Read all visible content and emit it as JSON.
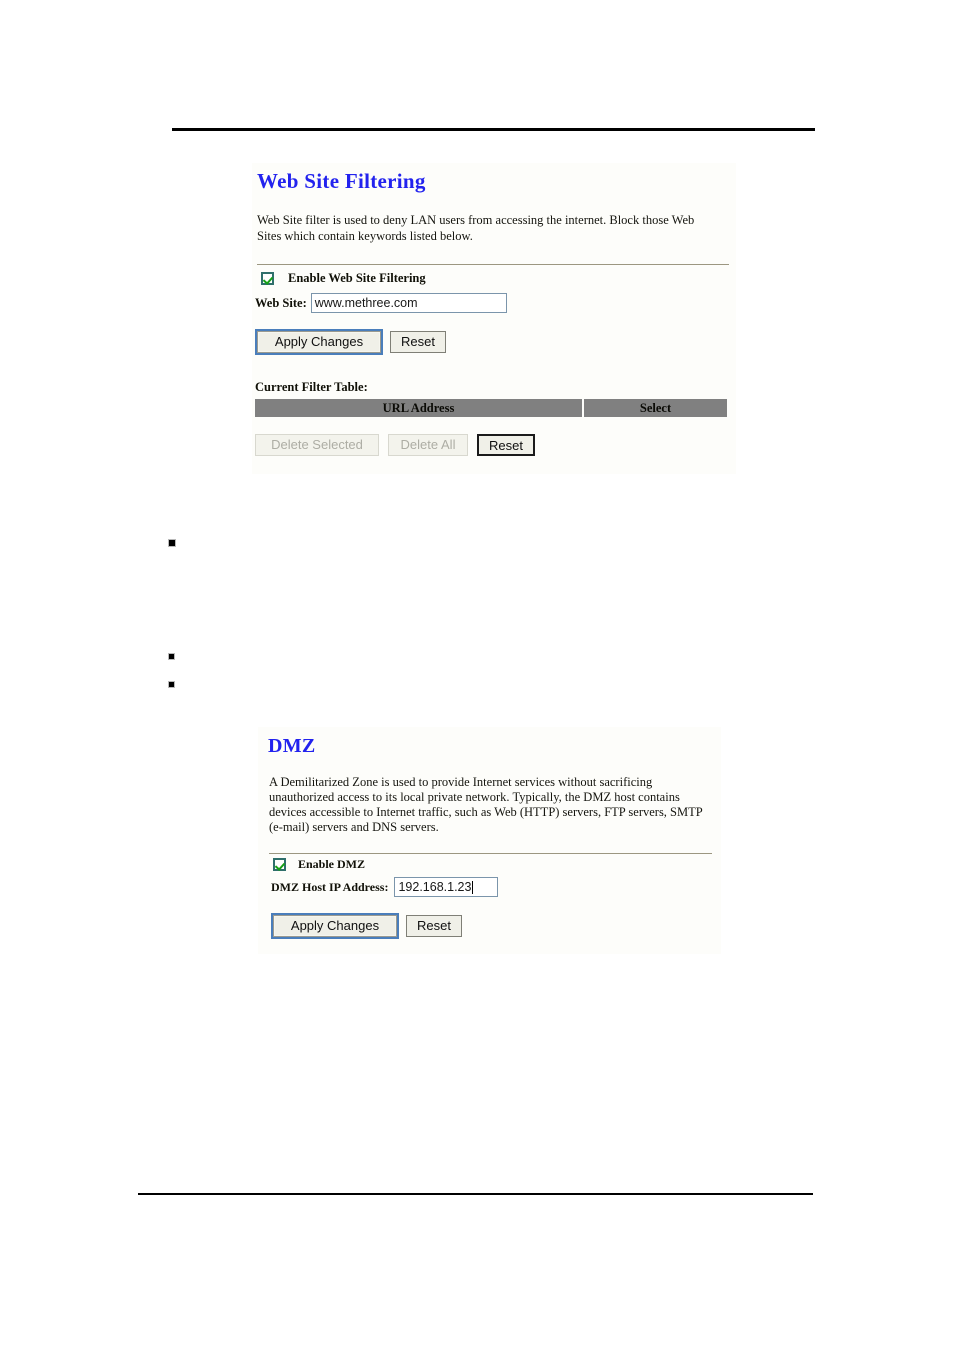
{
  "document": {
    "header_rule": true,
    "footer_rule": true,
    "bullets": [
      "",
      "",
      ""
    ]
  },
  "website_filtering": {
    "title": "Web Site Filtering",
    "description": "Web Site filter is used to deny LAN users from accessing the internet. Block those Web Sites which contain keywords listed below.",
    "enable_checkbox": {
      "label": "Enable Web Site Filtering",
      "checked": true,
      "icon": "checkbox-checked-icon"
    },
    "web_site_field": {
      "label": "Web Site:",
      "value": "www.methree.com",
      "placeholder": ""
    },
    "apply_label": "Apply Changes",
    "reset_label": "Reset",
    "table": {
      "caption": "Current Filter Table:",
      "columns": [
        "URL Address",
        "Select"
      ],
      "rows": [],
      "header_bg": "#808080"
    },
    "table_actions": {
      "delete_selected_label": "Delete Selected",
      "delete_selected_disabled": true,
      "delete_all_label": "Delete All",
      "delete_all_disabled": true,
      "reset_label": "Reset"
    }
  },
  "dmz": {
    "title": "DMZ",
    "description": "A Demilitarized Zone is used to provide Internet services without sacrificing unauthorized access to its local private network. Typically, the DMZ host contains devices accessible to Internet traffic, such as Web (HTTP) servers, FTP servers, SMTP (e-mail) servers and DNS servers.",
    "enable_checkbox": {
      "label": "Enable DMZ",
      "checked": true,
      "icon": "checkbox-checked-icon"
    },
    "host_ip_field": {
      "label": "DMZ Host IP Address:",
      "value": "192.168.1.23",
      "placeholder": ""
    },
    "apply_label": "Apply Changes",
    "reset_label": "Reset"
  },
  "colors": {
    "title_blue": "#2222ee",
    "table_header_gray": "#808080",
    "checkbox_border": "#2f6f6b",
    "check_green": "#15a015",
    "input_border": "#7b95ab",
    "focus_blue": "#4a7ebb",
    "panel_bg": "#fdfdfa",
    "rule_tan": "#9c9781"
  }
}
